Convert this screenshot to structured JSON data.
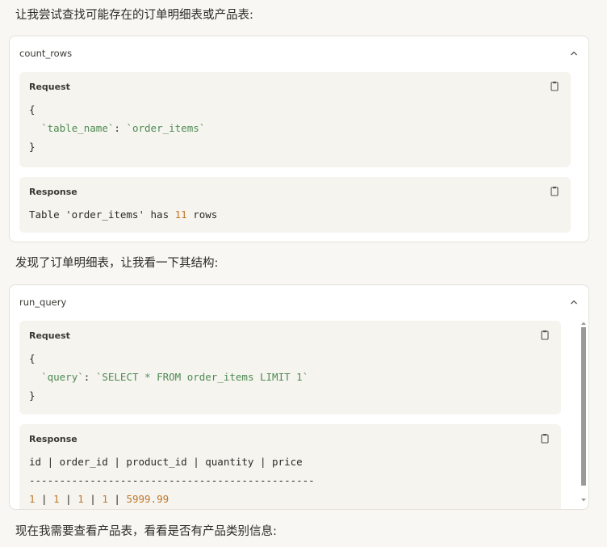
{
  "messages": [
    {
      "text": "让我尝试查找可能存在的订单明细表或产品表:"
    },
    {
      "text": "发现了订单明细表，让我看一下其结构:"
    },
    {
      "text": "现在我需要查看产品表，看看是否有产品类别信息:"
    }
  ],
  "tool_calls": [
    {
      "name": "count_rows",
      "request_label": "Request",
      "response_label": "Response",
      "request": {
        "open": "{",
        "key": "`table_name`",
        "colon": ": ",
        "value": "`order_items`",
        "close": "}"
      },
      "response": {
        "pre": "Table 'order_items' has ",
        "num": "11",
        "post": " rows"
      }
    },
    {
      "name": "run_query",
      "request_label": "Request",
      "response_label": "Response",
      "request": {
        "open": "{",
        "key": "`query`",
        "colon": ": ",
        "value": "`SELECT * FROM order_items LIMIT 1`",
        "close": "}"
      },
      "response": {
        "header": "id | order_id | product_id | quantity | price",
        "divider": "-----------------------------------------------",
        "row": {
          "c1": "1",
          "c2": "1",
          "c3": "1",
          "c4": "1",
          "c5": "5999.99",
          "sep": " | "
        }
      }
    }
  ],
  "icons": {
    "collapse": "chevron-up-icon",
    "copy": "copy-icon"
  },
  "colors": {
    "string": "#4e8a52",
    "number": "#c0782b",
    "background": "#f8f7f3",
    "card": "#ffffff"
  }
}
